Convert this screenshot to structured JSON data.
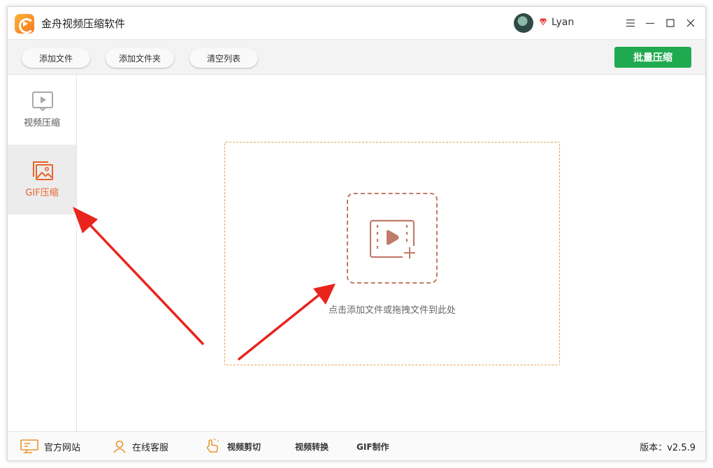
{
  "app": {
    "title": "金舟视频压缩软件"
  },
  "user": {
    "name": "Lyan"
  },
  "window_controls": {
    "menu_icon": "menu-icon",
    "minimize_icon": "minimize-icon",
    "maximize_icon": "maximize-icon",
    "close_icon": "close-icon"
  },
  "toolbar": {
    "add_file": "添加文件",
    "add_folder": "添加文件夹",
    "clear_list": "清空列表",
    "batch_compress": "批量压缩"
  },
  "sidebar": {
    "items": [
      {
        "label": "视频压缩",
        "icon": "video-play-icon",
        "active": false
      },
      {
        "label": "GIF压缩",
        "icon": "image-icon",
        "active": true
      }
    ]
  },
  "main": {
    "drop_hint": "点击添加文件或拖拽文件到此处",
    "add_icon": "add-video-icon"
  },
  "footer": {
    "official_site": "官方网站",
    "online_support": "在线客服",
    "video_cut": "视频剪切",
    "video_convert": "视频转换",
    "gif_make": "GIF制作",
    "version": "版本：v2.5.9"
  },
  "colors": {
    "accent_green": "#1faa4f",
    "active_orange": "#e8642a",
    "dashed_border": "#e3a55a",
    "arrow_red": "#e8241c"
  }
}
